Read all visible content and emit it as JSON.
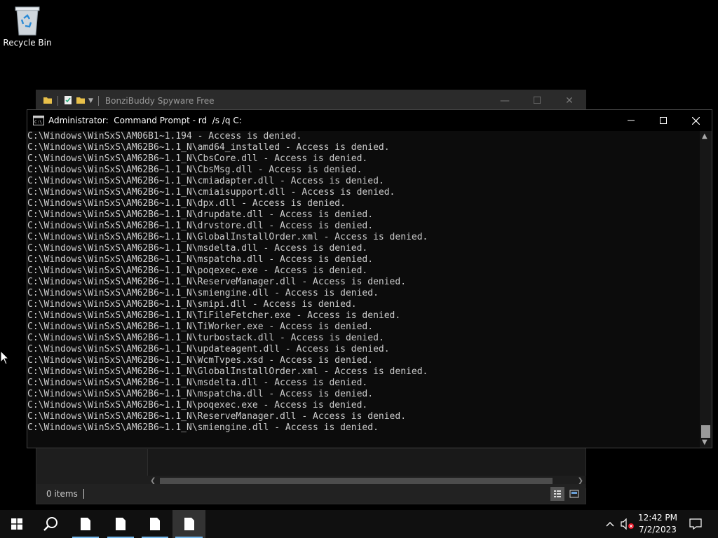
{
  "desktop": {
    "icons": [
      {
        "label": "Recycle Bin"
      }
    ]
  },
  "explorer": {
    "title": "BonziBuddy Spyware Free",
    "status_items": "0 items"
  },
  "cmd": {
    "title": "Administrator:  Command Prompt - rd  /s /q C:",
    "lines": [
      "C:\\Windows\\WinSxS\\AM06B1~1.194 - Access is denied.",
      "C:\\Windows\\WinSxS\\AM62B6~1.1_N\\amd64_installed - Access is denied.",
      "C:\\Windows\\WinSxS\\AM62B6~1.1_N\\CbsCore.dll - Access is denied.",
      "C:\\Windows\\WinSxS\\AM62B6~1.1_N\\CbsMsg.dll - Access is denied.",
      "C:\\Windows\\WinSxS\\AM62B6~1.1_N\\cmiadapter.dll - Access is denied.",
      "C:\\Windows\\WinSxS\\AM62B6~1.1_N\\cmiaisupport.dll - Access is denied.",
      "C:\\Windows\\WinSxS\\AM62B6~1.1_N\\dpx.dll - Access is denied.",
      "C:\\Windows\\WinSxS\\AM62B6~1.1_N\\drupdate.dll - Access is denied.",
      "C:\\Windows\\WinSxS\\AM62B6~1.1_N\\drvstore.dll - Access is denied.",
      "C:\\Windows\\WinSxS\\AM62B6~1.1_N\\GlobalInstallOrder.xml - Access is denied.",
      "C:\\Windows\\WinSxS\\AM62B6~1.1_N\\msdelta.dll - Access is denied.",
      "C:\\Windows\\WinSxS\\AM62B6~1.1_N\\mspatcha.dll - Access is denied.",
      "C:\\Windows\\WinSxS\\AM62B6~1.1_N\\poqexec.exe - Access is denied.",
      "C:\\Windows\\WinSxS\\AM62B6~1.1_N\\ReserveManager.dll - Access is denied.",
      "C:\\Windows\\WinSxS\\AM62B6~1.1_N\\smiengine.dll - Access is denied.",
      "C:\\Windows\\WinSxS\\AM62B6~1.1_N\\smipi.dll - Access is denied.",
      "C:\\Windows\\WinSxS\\AM62B6~1.1_N\\TiFileFetcher.exe - Access is denied.",
      "C:\\Windows\\WinSxS\\AM62B6~1.1_N\\TiWorker.exe - Access is denied.",
      "C:\\Windows\\WinSxS\\AM62B6~1.1_N\\turbostack.dll - Access is denied.",
      "C:\\Windows\\WinSxS\\AM62B6~1.1_N\\updateagent.dll - Access is denied.",
      "C:\\Windows\\WinSxS\\AM62B6~1.1_N\\WcmTvpes.xsd - Access is denied.",
      "C:\\Windows\\WinSxS\\AM62B6~1.1_N\\GlobalInstallOrder.xml - Access is denied.",
      "C:\\Windows\\WinSxS\\AM62B6~1.1_N\\msdelta.dll - Access is denied.",
      "C:\\Windows\\WinSxS\\AM62B6~1.1_N\\mspatcha.dll - Access is denied.",
      "C:\\Windows\\WinSxS\\AM62B6~1.1_N\\poqexec.exe - Access is denied.",
      "C:\\Windows\\WinSxS\\AM62B6~1.1_N\\ReserveManager.dll - Access is denied.",
      "C:\\Windows\\WinSxS\\AM62B6~1.1_N\\smiengine.dll - Access is denied."
    ]
  },
  "taskbar": {
    "time": "12:42 PM",
    "date": "7/2/2023",
    "accent": "#76b9ed"
  }
}
